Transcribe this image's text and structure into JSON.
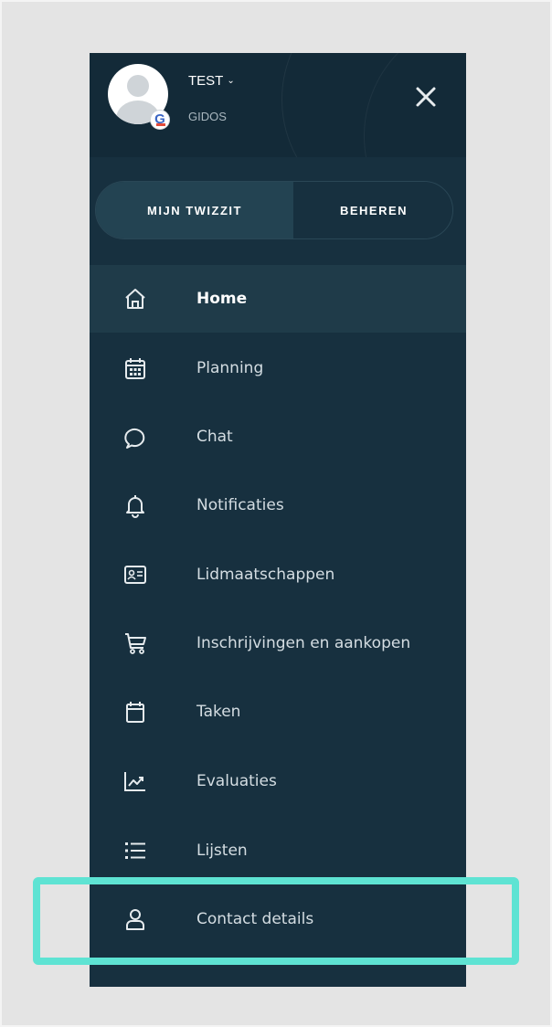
{
  "header": {
    "user_name": "TEST",
    "user_org": "GIDOS",
    "badge_letter": "G"
  },
  "toggle": {
    "left_label": "MIJN TWIZZIT",
    "right_label": "BEHEREN"
  },
  "menu": {
    "items": [
      {
        "label": "Home",
        "icon": "home-icon",
        "active": true
      },
      {
        "label": "Planning",
        "icon": "calendar-icon"
      },
      {
        "label": "Chat",
        "icon": "chat-bubble-icon"
      },
      {
        "label": "Notificaties",
        "icon": "bell-icon"
      },
      {
        "label": "Lidmaatschappen",
        "icon": "id-card-icon"
      },
      {
        "label": "Inschrijvingen en aankopen",
        "icon": "cart-icon"
      },
      {
        "label": "Taken",
        "icon": "task-calendar-icon"
      },
      {
        "label": "Evaluaties",
        "icon": "trend-chart-icon"
      },
      {
        "label": "Lijsten",
        "icon": "list-icon"
      },
      {
        "label": "Contact details",
        "icon": "user-icon"
      }
    ]
  },
  "colors": {
    "panel_bg": "#17303f",
    "header_bg": "#132a38",
    "active_bg": "#1f3b49",
    "highlight": "#5ee3d3",
    "page_bg": "#e4e4e4"
  }
}
